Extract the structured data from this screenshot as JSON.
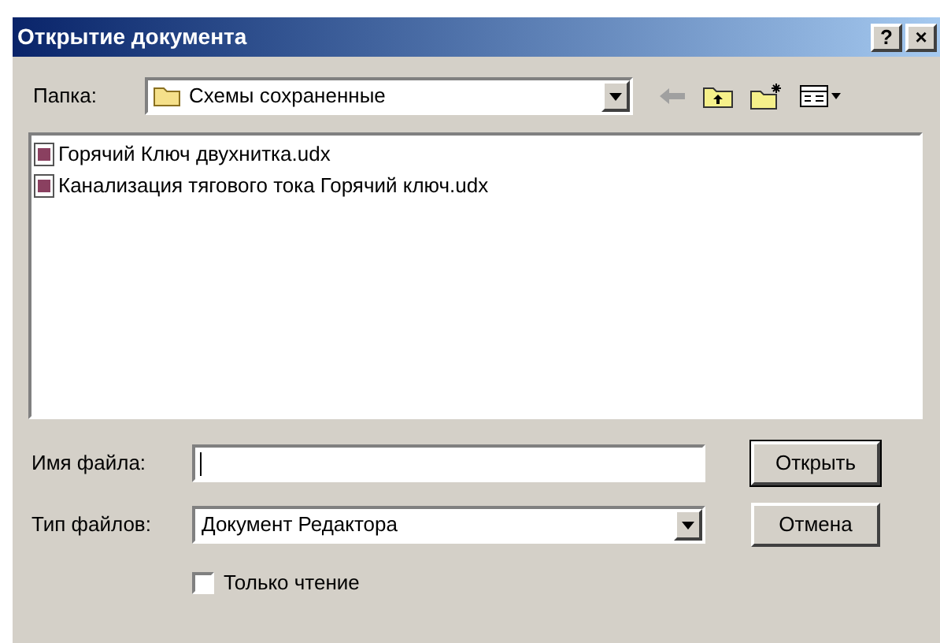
{
  "window": {
    "title": "Открытие документа",
    "buttons": [
      "?",
      "×"
    ]
  },
  "folder": {
    "label": "Папка:",
    "value": "Схемы сохраненные"
  },
  "files": [
    {
      "name": "Горячий Ключ двухнитка.udx",
      "selected": false
    },
    {
      "name": "Канализация тягового тока Горячий ключ.udx",
      "selected": false
    }
  ],
  "filename": {
    "label": "Имя файла:"
  },
  "filetype": {
    "label": "Тип файлов:",
    "value": "Документ Редактора"
  },
  "readonly": {
    "label": "Только чтение",
    "checked": false
  },
  "buttons": [
    {
      "label": "Открыть",
      "default": true
    },
    {
      "label": "Отмена",
      "default": false
    }
  ]
}
